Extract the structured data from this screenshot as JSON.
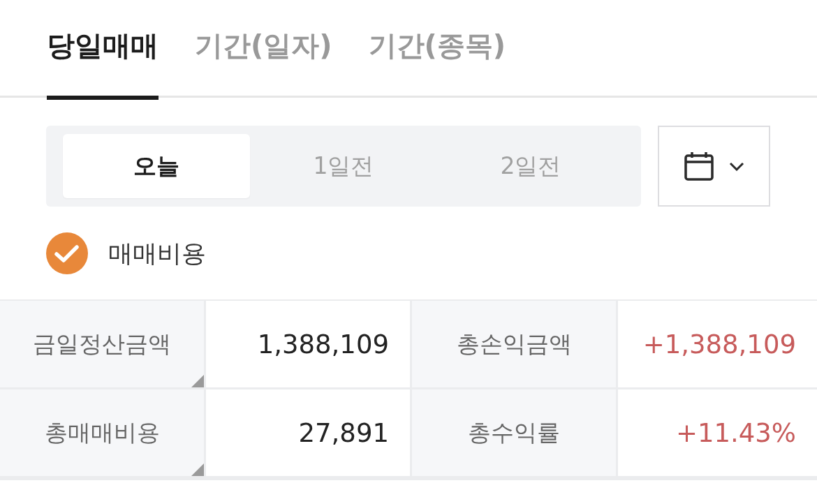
{
  "tabs": [
    {
      "label": "당일매매",
      "selected": true
    },
    {
      "label": "기간(일자)",
      "selected": false
    },
    {
      "label": "기간(종목)",
      "selected": false
    }
  ],
  "period_selector": {
    "options": [
      {
        "label": "오늘",
        "selected": true
      },
      {
        "label": "1일전",
        "selected": false
      },
      {
        "label": "2일전",
        "selected": false
      }
    ]
  },
  "fee_checkbox": {
    "label": "매매비용",
    "checked": true
  },
  "summary_table": {
    "rows": [
      {
        "cells": [
          {
            "kind": "label",
            "text": "금일정산금액",
            "note_marker": true
          },
          {
            "kind": "value",
            "text": "1,388,109",
            "color": "#222222"
          },
          {
            "kind": "label",
            "text": "총손익금액",
            "note_marker": false
          },
          {
            "kind": "value",
            "text": "+1,388,109",
            "color": "#c75b5b"
          }
        ]
      },
      {
        "cells": [
          {
            "kind": "label",
            "text": "총매매비용",
            "note_marker": true
          },
          {
            "kind": "value",
            "text": "27,891",
            "color": "#222222"
          },
          {
            "kind": "label",
            "text": "총수익률",
            "note_marker": false
          },
          {
            "kind": "value",
            "text": "+11.43%",
            "color": "#c75b5b"
          }
        ]
      }
    ]
  }
}
